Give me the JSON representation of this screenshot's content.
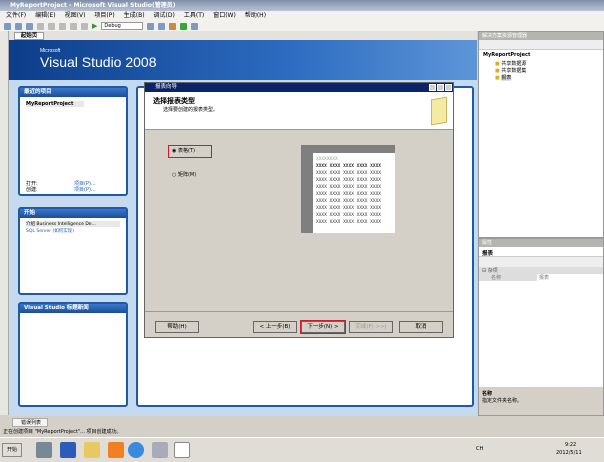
{
  "window": {
    "title": "MyReportProject - Microsoft Visual Studio(管理员)"
  },
  "menu": [
    "文件(F)",
    "编辑(E)",
    "视图(V)",
    "项目(P)",
    "生成(B)",
    "调试(D)",
    "工具(T)",
    "窗口(W)",
    "帮助(H)"
  ],
  "toolbar": {
    "config": "Debug"
  },
  "doc_tab": "起始页",
  "banner": {
    "brand_small": "Microsoft",
    "brand": "Visual Studio 2008"
  },
  "recent": {
    "title": "最近的项目",
    "item": "MyReportProject",
    "open_label": "打开:",
    "create_label": "创建:",
    "open_link": "项目(P)...",
    "create_link": "项目(P)..."
  },
  "start": {
    "title": "开始",
    "items": [
      "介绍 Business Intelligence De...",
      "SQL Server (如何实现)"
    ]
  },
  "news": {
    "title": "Visual Studio 标题新闻"
  },
  "dialog": {
    "title": "报表向导",
    "heading": "选择报表类型",
    "subheading": "选择要创建的报表类型。",
    "options": [
      {
        "label": "表格(T)",
        "checked": true
      },
      {
        "label": "矩阵(M)",
        "checked": false
      }
    ],
    "preview": {
      "title": "XXXXXXXX",
      "cell": "XXXX"
    },
    "buttons": {
      "help": "帮助(H)",
      "back": "< 上一步(B)",
      "next": "下一步(N) >",
      "finish": "完成(F) >>|",
      "cancel": "取消"
    }
  },
  "solution_explorer": {
    "title": "解决方案资源管理器",
    "project": "MyReportProject",
    "folders": [
      "共享数据源",
      "共享数据集",
      "报表"
    ]
  },
  "properties": {
    "title": "属性",
    "object": "报表",
    "category": "杂项",
    "prop_name": "名称",
    "prop_value": "报表",
    "desc_title": "名称",
    "desc_text": "指定文件夹名称。"
  },
  "error_tab": "错误列表",
  "status": "正在创建项目 \"MyReportProject\"... 项目创建成功。",
  "taskbar": {
    "start": "开始",
    "lang": "CH",
    "time": "9:22",
    "date": "2012/5/11"
  }
}
